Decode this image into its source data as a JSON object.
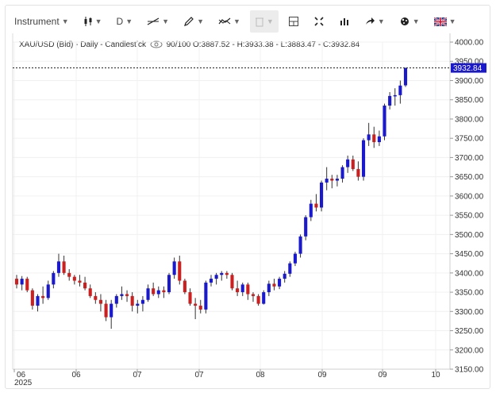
{
  "toolbar": {
    "instrument_label": "Instrument",
    "interval_label": "D",
    "icons": [
      "candlestick-type-icon",
      "line-tool-icon",
      "pencil-tool-icon",
      "indicator-icon",
      "trash-icon",
      "crosshair-icon",
      "fullscreen-icon",
      "volume-icon",
      "share-icon",
      "settings-icon",
      "language-flag-icon"
    ]
  },
  "chart_title": {
    "symbol": "XAU/USD (Bid) - Daily - Candlestick",
    "quality": "90/100",
    "ohlc": "O:3887.52 - H:3933.38 - L:3883.47 - C:3932.84"
  },
  "chart_data": {
    "type": "candlestick",
    "ylim": [
      3150,
      4000
    ],
    "yticks": [
      "4000.00",
      "3950.00",
      "3900.00",
      "3850.00",
      "3800.00",
      "3750.00",
      "3700.00",
      "3650.00",
      "3600.00",
      "3550.00",
      "3500.00",
      "3450.00",
      "3400.00",
      "3350.00",
      "3300.00",
      "3250.00",
      "3200.00",
      "3150.00"
    ],
    "xtick_labels": [
      "06",
      "06",
      "07",
      "07",
      "08",
      "09",
      "09",
      "10"
    ],
    "year_label": "2025",
    "last_price": "3932.84",
    "up_color": "#1a1acc",
    "down_color": "#cc1f1f",
    "candles": [
      [
        3385,
        3395,
        3360,
        3370
      ],
      [
        3370,
        3392,
        3355,
        3385
      ],
      [
        3385,
        3390,
        3350,
        3355
      ],
      [
        3355,
        3360,
        3305,
        3315
      ],
      [
        3315,
        3345,
        3300,
        3340
      ],
      [
        3340,
        3365,
        3320,
        3335
      ],
      [
        3335,
        3380,
        3330,
        3370
      ],
      [
        3370,
        3405,
        3360,
        3400
      ],
      [
        3400,
        3450,
        3390,
        3430
      ],
      [
        3430,
        3445,
        3395,
        3400
      ],
      [
        3400,
        3410,
        3380,
        3390
      ],
      [
        3390,
        3395,
        3370,
        3380
      ],
      [
        3380,
        3395,
        3365,
        3375
      ],
      [
        3375,
        3390,
        3355,
        3360
      ],
      [
        3360,
        3370,
        3335,
        3340
      ],
      [
        3340,
        3350,
        3320,
        3330
      ],
      [
        3330,
        3345,
        3300,
        3320
      ],
      [
        3320,
        3330,
        3275,
        3285
      ],
      [
        3285,
        3330,
        3255,
        3320
      ],
      [
        3320,
        3345,
        3310,
        3340
      ],
      [
        3340,
        3365,
        3330,
        3345
      ],
      [
        3345,
        3355,
        3325,
        3340
      ],
      [
        3340,
        3350,
        3300,
        3315
      ],
      [
        3315,
        3330,
        3295,
        3320
      ],
      [
        3320,
        3340,
        3300,
        3330
      ],
      [
        3330,
        3370,
        3325,
        3360
      ],
      [
        3360,
        3375,
        3340,
        3345
      ],
      [
        3345,
        3365,
        3335,
        3355
      ],
      [
        3355,
        3365,
        3335,
        3350
      ],
      [
        3350,
        3400,
        3345,
        3395
      ],
      [
        3395,
        3440,
        3385,
        3430
      ],
      [
        3430,
        3445,
        3370,
        3380
      ],
      [
        3380,
        3385,
        3345,
        3350
      ],
      [
        3350,
        3360,
        3315,
        3320
      ],
      [
        3320,
        3335,
        3280,
        3315
      ],
      [
        3315,
        3330,
        3295,
        3305
      ],
      [
        3305,
        3380,
        3295,
        3375
      ],
      [
        3375,
        3395,
        3365,
        3385
      ],
      [
        3385,
        3400,
        3370,
        3395
      ],
      [
        3395,
        3405,
        3380,
        3400
      ],
      [
        3400,
        3405,
        3385,
        3395
      ],
      [
        3395,
        3400,
        3355,
        3360
      ],
      [
        3360,
        3380,
        3340,
        3350
      ],
      [
        3350,
        3375,
        3340,
        3370
      ],
      [
        3370,
        3375,
        3330,
        3345
      ],
      [
        3345,
        3350,
        3325,
        3340
      ],
      [
        3340,
        3345,
        3315,
        3320
      ],
      [
        3320,
        3355,
        3318,
        3350
      ],
      [
        3350,
        3380,
        3340,
        3372
      ],
      [
        3372,
        3385,
        3355,
        3365
      ],
      [
        3365,
        3390,
        3358,
        3385
      ],
      [
        3385,
        3405,
        3375,
        3398
      ],
      [
        3398,
        3430,
        3390,
        3425
      ],
      [
        3425,
        3455,
        3418,
        3450
      ],
      [
        3450,
        3500,
        3440,
        3495
      ],
      [
        3495,
        3550,
        3485,
        3545
      ],
      [
        3545,
        3590,
        3535,
        3580
      ],
      [
        3580,
        3605,
        3560,
        3570
      ],
      [
        3570,
        3640,
        3560,
        3635
      ],
      [
        3635,
        3675,
        3615,
        3645
      ],
      [
        3645,
        3655,
        3620,
        3640
      ],
      [
        3640,
        3655,
        3625,
        3645
      ],
      [
        3645,
        3680,
        3635,
        3675
      ],
      [
        3675,
        3705,
        3660,
        3695
      ],
      [
        3695,
        3705,
        3665,
        3670
      ],
      [
        3670,
        3690,
        3640,
        3650
      ],
      [
        3650,
        3750,
        3640,
        3745
      ],
      [
        3745,
        3790,
        3730,
        3760
      ],
      [
        3760,
        3780,
        3725,
        3740
      ],
      [
        3740,
        3770,
        3730,
        3755
      ],
      [
        3755,
        3840,
        3745,
        3835
      ],
      [
        3835,
        3870,
        3825,
        3860
      ],
      [
        3860,
        3880,
        3835,
        3862
      ],
      [
        3862,
        3900,
        3840,
        3887
      ],
      [
        3887.52,
        3933.38,
        3883.47,
        3932.84
      ]
    ]
  }
}
